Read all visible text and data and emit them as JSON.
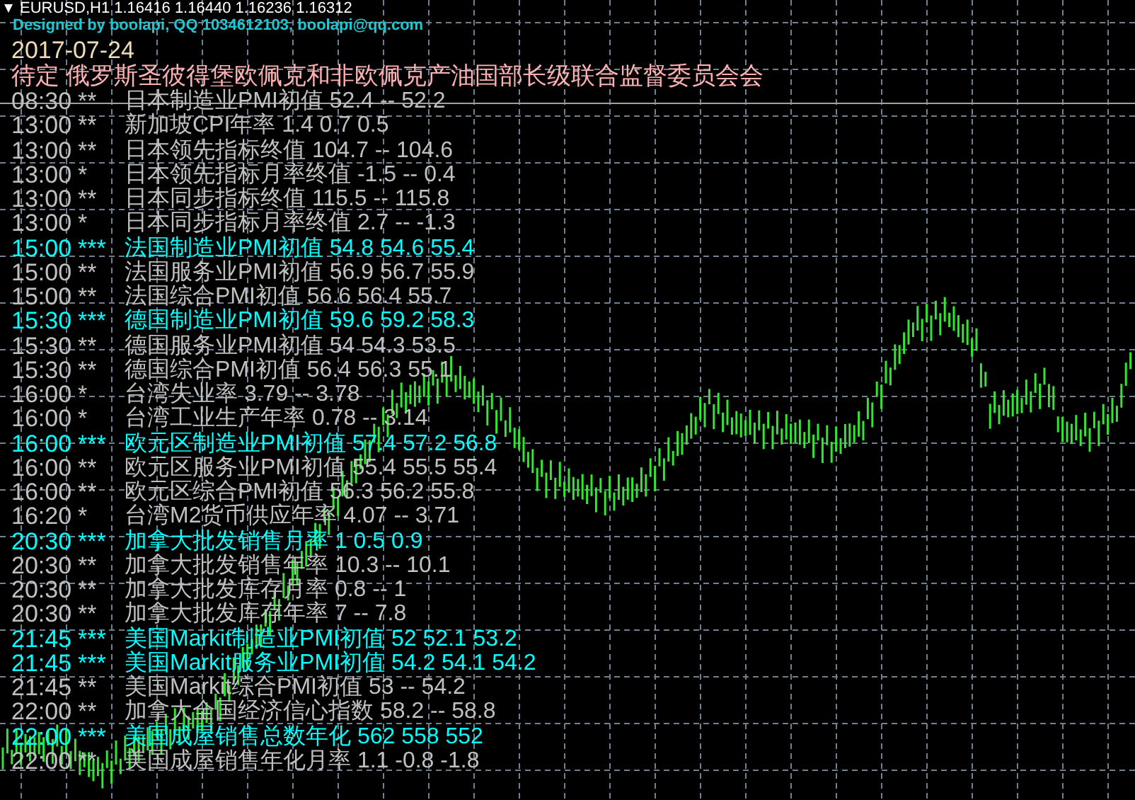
{
  "chart_header": {
    "text": "EURUSD,H1 1.16416 1.16440 1.16236 1.16312"
  },
  "credit": "Designed by boolapi, QQ 1034612103, boolapi@qq.com",
  "date": "2017-07-24",
  "headline": "待定 俄罗斯圣彼得堡欧佩克和非欧佩克产油国部长级联合监督委员会会",
  "events": [
    {
      "time": "08:30",
      "stars": "**",
      "text": "日本制造业PMI初值 52.4 -- 52.2",
      "color": "#c0c0c0"
    },
    {
      "time": "13:00",
      "stars": "**",
      "text": "新加坡CPI年率 1.4 0.7 0.5",
      "color": "#c0c0c0"
    },
    {
      "time": "13:00",
      "stars": "**",
      "text": "日本领先指标终值 104.7 -- 104.6",
      "color": "#c0c0c0"
    },
    {
      "time": "13:00",
      "stars": "*",
      "text": "日本领先指标月率终值 -1.5 -- 0.4",
      "color": "#c0c0c0"
    },
    {
      "time": "13:00",
      "stars": "**",
      "text": "日本同步指标终值 115.5 -- 115.8",
      "color": "#c0c0c0"
    },
    {
      "time": "13:00",
      "stars": "*",
      "text": "日本同步指标月率终值 2.7 -- -1.3",
      "color": "#c0c0c0"
    },
    {
      "time": "15:00",
      "stars": "***",
      "text": "法国制造业PMI初值 54.8 54.6 55.4",
      "color": "#00ffff"
    },
    {
      "time": "15:00",
      "stars": "**",
      "text": "法国服务业PMI初值 56.9 56.7 55.9",
      "color": "#c0c0c0"
    },
    {
      "time": "15:00",
      "stars": "**",
      "text": "法国综合PMI初值 56.6 56.4 55.7",
      "color": "#c0c0c0"
    },
    {
      "time": "15:30",
      "stars": "***",
      "text": "德国制造业PMI初值 59.6 59.2 58.3",
      "color": "#00ffff"
    },
    {
      "time": "15:30",
      "stars": "**",
      "text": "德国服务业PMI初值 54 54.3 53.5",
      "color": "#c0c0c0"
    },
    {
      "time": "15:30",
      "stars": "**",
      "text": "德国综合PMI初值 56.4 56.3 55.1",
      "color": "#c0c0c0"
    },
    {
      "time": "16:00",
      "stars": "*",
      "text": "台湾失业率 3.79 -- 3.78",
      "color": "#c0c0c0"
    },
    {
      "time": "16:00",
      "stars": "*",
      "text": "台湾工业生产年率 0.78 -- 3.14",
      "color": "#c0c0c0"
    },
    {
      "time": "16:00",
      "stars": "***",
      "text": "欧元区制造业PMI初值 57.4 57.2 56.8",
      "color": "#00ffff"
    },
    {
      "time": "16:00",
      "stars": "**",
      "text": "欧元区服务业PMI初值 55.4 55.5 55.4",
      "color": "#c0c0c0"
    },
    {
      "time": "16:00",
      "stars": "**",
      "text": "欧元区综合PMI初值 56.3 56.2 55.8",
      "color": "#c0c0c0"
    },
    {
      "time": "16:20",
      "stars": "*",
      "text": "台湾M2货币供应年率 4.07 -- 3.71",
      "color": "#c0c0c0"
    },
    {
      "time": "20:30",
      "stars": "***",
      "text": "加拿大批发销售月率 1 0.5 0.9",
      "color": "#00ffff"
    },
    {
      "time": "20:30",
      "stars": "**",
      "text": "加拿大批发销售年率 10.3 -- 10.1",
      "color": "#c0c0c0"
    },
    {
      "time": "20:30",
      "stars": "**",
      "text": "加拿大批发库存月率 0.8 -- 1",
      "color": "#c0c0c0"
    },
    {
      "time": "20:30",
      "stars": "**",
      "text": "加拿大批发库存年率 7 -- 7.8",
      "color": "#c0c0c0"
    },
    {
      "time": "21:45",
      "stars": "***",
      "text": "美国Markit制造业PMI初值 52 52.1 53.2",
      "color": "#00ffff"
    },
    {
      "time": "21:45",
      "stars": "***",
      "text": "美国Markit服务业PMI初值 54.2 54.1 54.2",
      "color": "#00ffff"
    },
    {
      "time": "21:45",
      "stars": "**",
      "text": "美国Markit综合PMI初值 53 -- 54.2",
      "color": "#c0c0c0"
    },
    {
      "time": "22:00",
      "stars": "**",
      "text": "加拿大全国经济信心指数 58.2 -- 58.8",
      "color": "#c0c0c0"
    },
    {
      "time": "22:00",
      "stars": "***",
      "text": "美国成屋销售总数年化 562 558 552",
      "color": "#00ffff"
    },
    {
      "time": "22:00",
      "stars": "**",
      "text": "美国成屋销售年化月率 1.1 -0.8 -1.8",
      "color": "#c0c0c0"
    }
  ]
}
